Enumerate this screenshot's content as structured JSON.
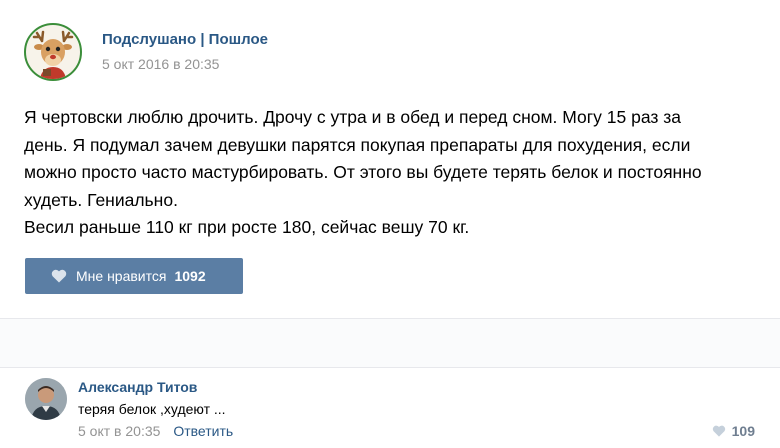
{
  "post": {
    "group_name": "Подслушано | Пошлое",
    "date": "5 окт 2016 в 20:35",
    "text_lines": [
      "Я чертовски люблю дрочить. Дрочу с утра и в обед и перед сном. Могу 15 раз за",
      "день. Я подумал зачем девушки парятся покупая препараты для похудения, если",
      "можно просто часто мастурбировать. От этого вы будете терять белок и постоянно",
      "худеть. Гениально.",
      "Весил раньше 110 кг при росте 180, сейчас вешу 70 кг."
    ],
    "like_label": "Мне нравится",
    "like_count": "1092",
    "avatar_icon": "deer-icon"
  },
  "comment": {
    "author": "Александр Титов",
    "text": "теряя белок ,худеют ...",
    "date": "5 окт в 20:35",
    "reply_label": "Ответить",
    "likes": "109"
  },
  "colors": {
    "link": "#2a5885",
    "like_button": "#5b7ea4",
    "meta_gray": "#939393",
    "avatar_border": "#3b8e3a"
  }
}
